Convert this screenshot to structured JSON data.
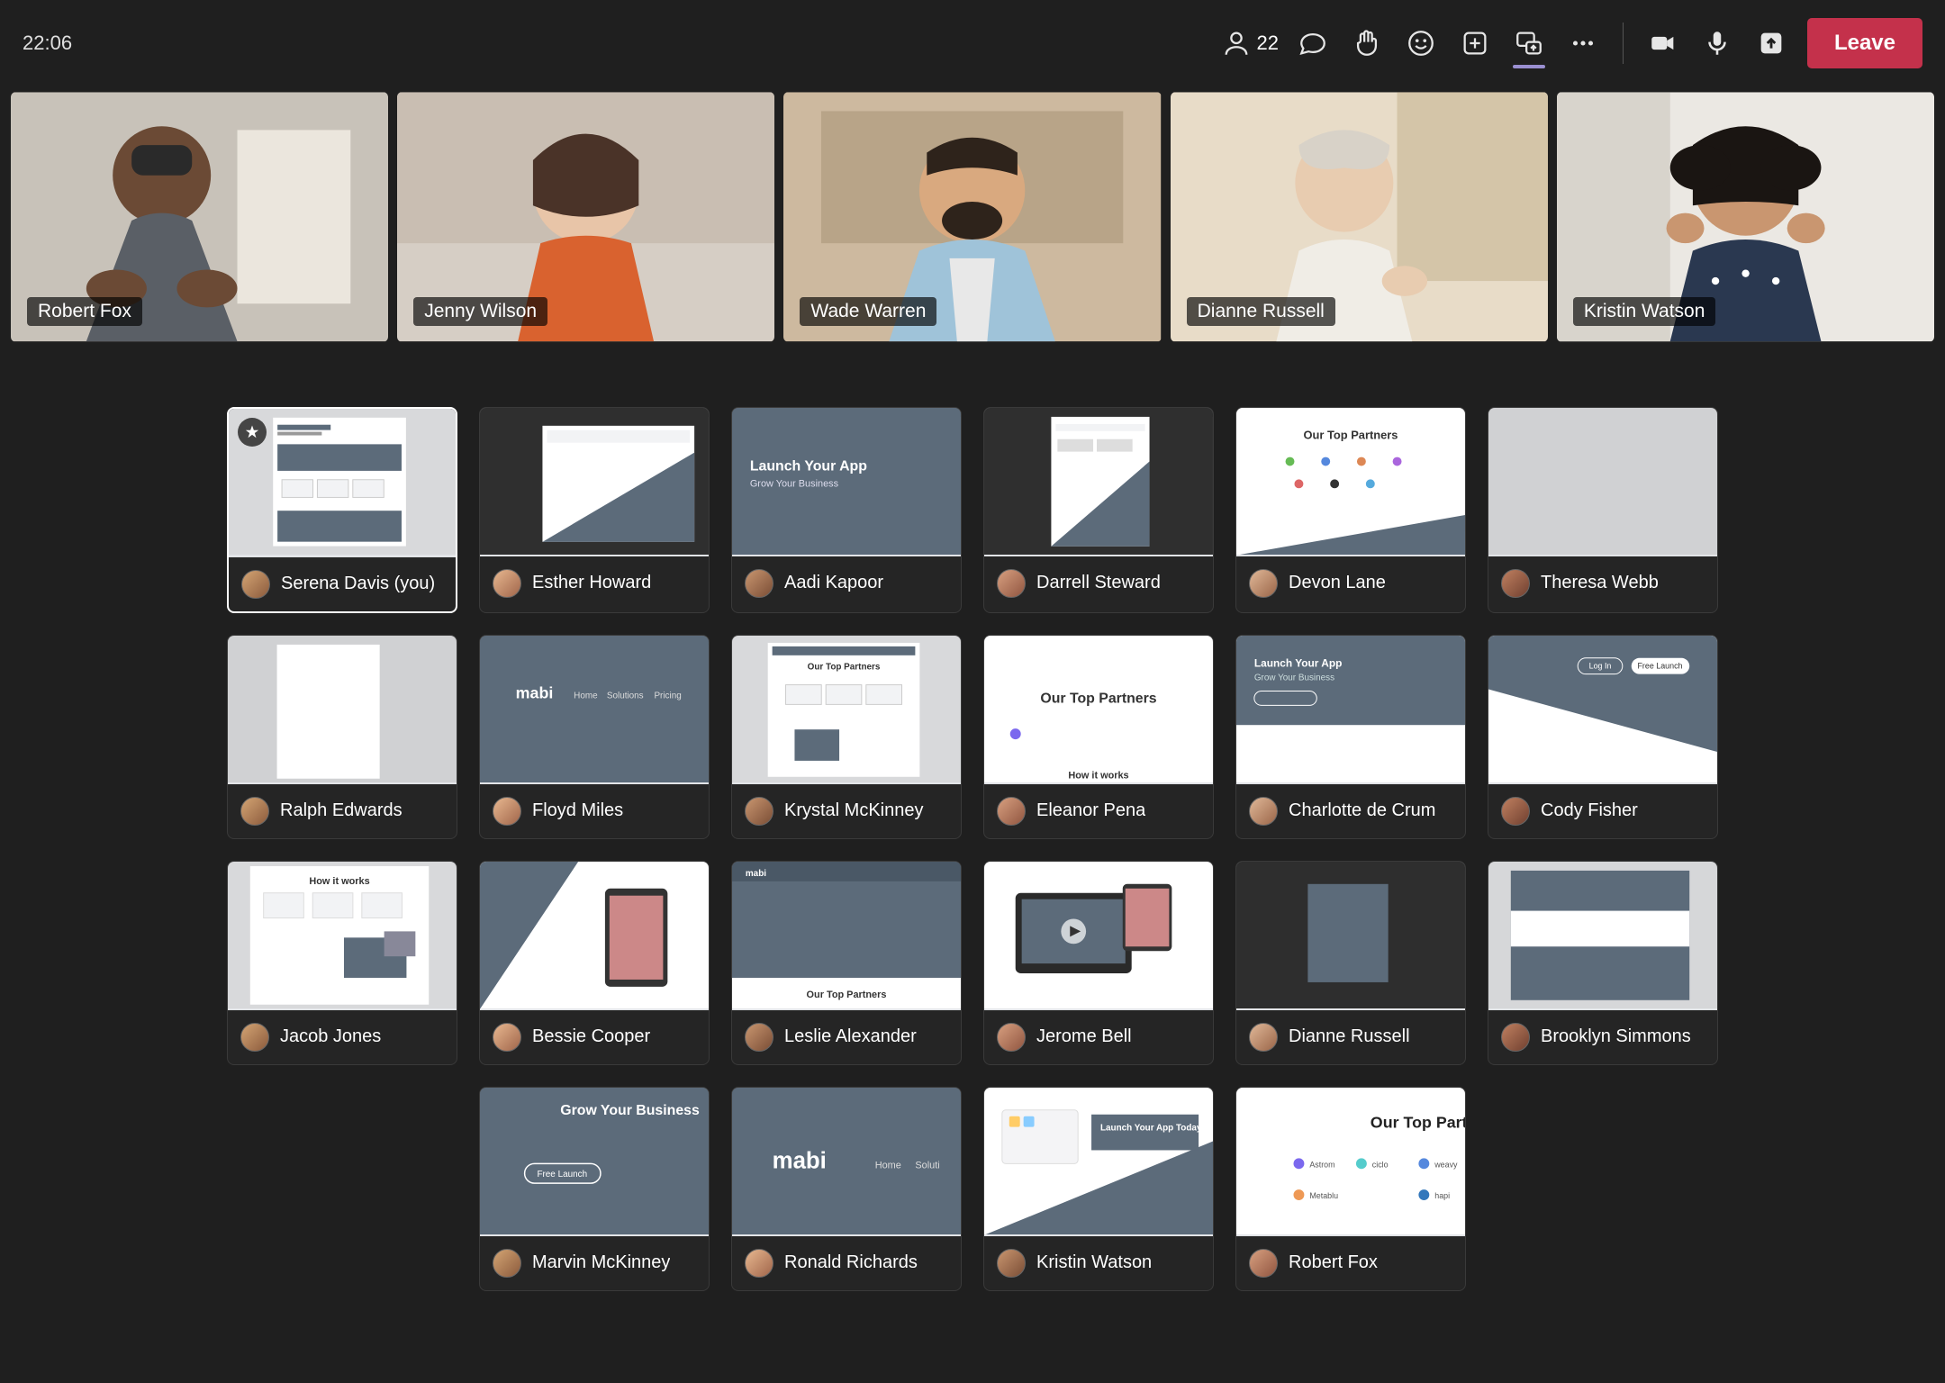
{
  "toolbar": {
    "time": "22:06",
    "participant_count": "22",
    "leave_label": "Leave"
  },
  "videos": [
    {
      "name": "Robert Fox"
    },
    {
      "name": "Jenny Wilson"
    },
    {
      "name": "Wade Warren"
    },
    {
      "name": "Dianne Russell"
    },
    {
      "name": "Kristin Watson"
    }
  ],
  "shares": [
    {
      "name": "Serena Davis (you)",
      "selected": true,
      "star": true,
      "variant": 0
    },
    {
      "name": "Esther Howard",
      "variant": 1
    },
    {
      "name": "Aadi Kapoor",
      "variant": 2
    },
    {
      "name": "Darrell Steward",
      "variant": 3
    },
    {
      "name": "Devon Lane",
      "variant": 4
    },
    {
      "name": "Theresa Webb",
      "variant": 5
    },
    {
      "name": "Ralph Edwards",
      "variant": 6
    },
    {
      "name": "Floyd Miles",
      "variant": 7
    },
    {
      "name": "Krystal McKinney",
      "variant": 8
    },
    {
      "name": "Eleanor Pena",
      "variant": 9
    },
    {
      "name": "Charlotte de Crum",
      "variant": 10
    },
    {
      "name": "Cody Fisher",
      "variant": 11
    },
    {
      "name": "Jacob Jones",
      "variant": 12
    },
    {
      "name": "Bessie Cooper",
      "variant": 13
    },
    {
      "name": "Leslie Alexander",
      "variant": 14
    },
    {
      "name": "Jerome Bell",
      "variant": 15
    },
    {
      "name": "Dianne Russell",
      "variant": 16
    },
    {
      "name": "Brooklyn Simmons",
      "variant": 17
    },
    {
      "name": "Marvin McKinney",
      "variant": 18
    },
    {
      "name": "Ronald Richards",
      "variant": 19
    },
    {
      "name": "Kristin Watson",
      "variant": 20
    },
    {
      "name": "Robert Fox",
      "variant": 21
    }
  ],
  "thumb_text": {
    "launch": "Launch Your App",
    "grow": "Grow Your Business",
    "partners": "Our Top Partners",
    "mabi": "mabi",
    "howit": "How it works",
    "login": "Log In",
    "free": "Free Launch",
    "home": "Home",
    "solutions": "Solutions",
    "pricing": "Pricing",
    "today": "Launch Your App Today",
    "growbiz": "Grow Your Business"
  }
}
